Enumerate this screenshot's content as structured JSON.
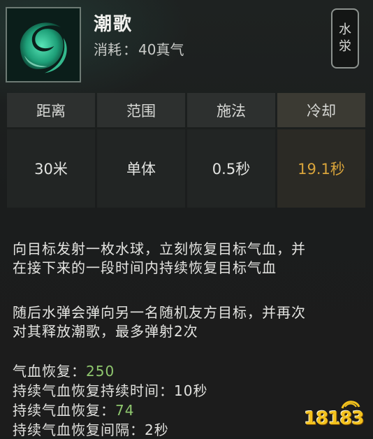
{
  "skill": {
    "name": "潮歌",
    "cost_label": "消耗",
    "cost_sep": "：",
    "cost_value": "40真气",
    "icon": "water-swirl-icon",
    "element_line1": "水",
    "element_line2": "泶"
  },
  "stats": [
    {
      "label": "距离",
      "value": "30米"
    },
    {
      "label": "范围",
      "value": "单体"
    },
    {
      "label": "施法",
      "value": "0.5秒"
    },
    {
      "label": "冷却",
      "value": "19.1秒"
    }
  ],
  "description": {
    "para1_line1": "向目标发射一枚水球，立刻恢复目标气血，并",
    "para1_line2": "在接下来的一段时间内持续恢复目标气血",
    "para2_line1": "随后水弹会弹向另一名随机友方目标，并再次",
    "para2_line2": "对其释放潮歌，最多弹射2次"
  },
  "effects": [
    {
      "label": "气血恢复：",
      "value": "250"
    },
    {
      "label": "持续气血恢复持续时间：",
      "value": "10秒"
    },
    {
      "label": "持续气血恢复：",
      "value": "74"
    },
    {
      "label": "持续气血恢复间隔：",
      "value": "2秒"
    }
  ],
  "watermark": {
    "text": "18183"
  },
  "colors": {
    "cooldown": "#d9a43b",
    "highlight_value": "#8fc76e",
    "watermark": "#f3c21d"
  }
}
